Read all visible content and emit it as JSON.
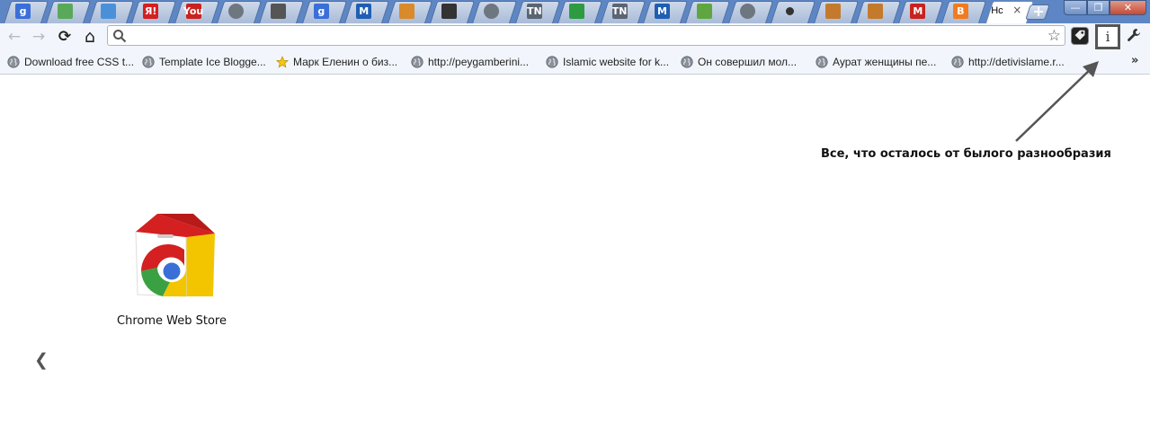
{
  "tabs": [
    {
      "icon": "google-icon",
      "label": "g",
      "color": "#3b6fd8"
    },
    {
      "icon": "picasa-icon",
      "label": "",
      "color": "#5aa85a"
    },
    {
      "icon": "document-icon",
      "label": "",
      "color": "#4a90d9"
    },
    {
      "icon": "yandex-icon",
      "label": "Я!",
      "color": "#d42020"
    },
    {
      "icon": "youtube-icon",
      "label": "You",
      "color": "#c8231f"
    },
    {
      "icon": "globe-icon",
      "label": "",
      "color": "#6e7680"
    },
    {
      "icon": "target-icon",
      "label": "",
      "color": "#555555"
    },
    {
      "icon": "google-icon",
      "label": "g",
      "color": "#3b6fd8"
    },
    {
      "icon": "m-icon",
      "label": "M",
      "color": "#1f5fb3"
    },
    {
      "icon": "compass-icon",
      "label": "",
      "color": "#d98a2b"
    },
    {
      "icon": "avatar-icon",
      "label": "",
      "color": "#333333"
    },
    {
      "icon": "globe-icon",
      "label": "",
      "color": "#6e7680"
    },
    {
      "icon": "tn-icon",
      "label": "TN",
      "color": "#5a6473"
    },
    {
      "icon": "windows-icon",
      "label": "",
      "color": "#2e9b43"
    },
    {
      "icon": "tn-icon",
      "label": "TN",
      "color": "#5a6473"
    },
    {
      "icon": "m-icon",
      "label": "M",
      "color": "#1f5fb3"
    },
    {
      "icon": "money-icon",
      "label": "",
      "color": "#5fa640"
    },
    {
      "icon": "globe-icon",
      "label": "",
      "color": "#6e7680"
    },
    {
      "icon": "dot-icon",
      "label": "",
      "color": "#333333"
    },
    {
      "icon": "food-icon",
      "label": "",
      "color": "#c47a2c"
    },
    {
      "icon": "food-icon",
      "label": "",
      "color": "#c47a2c"
    },
    {
      "icon": "gmail-icon",
      "label": "M",
      "color": "#c8231f"
    },
    {
      "icon": "blogger-icon",
      "label": "B",
      "color": "#f07c22"
    }
  ],
  "active_tab": {
    "title": "Нс",
    "close": "×"
  },
  "new_tab_label": "+",
  "window_controls": {
    "minimize": "—",
    "maximize": "❐",
    "close": "✕"
  },
  "toolbar": {
    "back": "←",
    "forward": "→",
    "reload": "⟳",
    "home": "⌂",
    "star": "☆",
    "wrench": "🔧",
    "ext_info": "i"
  },
  "omnibox": {
    "value": ""
  },
  "bookmarks": [
    {
      "label": "Download free CSS t...",
      "icon": "globe-icon"
    },
    {
      "label": "Template Ice Blogge...",
      "icon": "globe-icon"
    },
    {
      "label": "Марк Еленин о биз...",
      "icon": "star-icon"
    },
    {
      "label": "http://peygamberini...",
      "icon": "globe-icon"
    },
    {
      "label": "Islamic website for k...",
      "icon": "globe-icon"
    },
    {
      "label": "Он совершил мол...",
      "icon": "globe-icon"
    },
    {
      "label": "Аурат женщины пе...",
      "icon": "globe-icon"
    },
    {
      "label": "http://detivislame.r...",
      "icon": "globe-icon"
    }
  ],
  "bookmarks_more": "»",
  "annotation": "Все, что осталось от былого разнообразия",
  "apps": [
    {
      "label": "Chrome Web Store"
    }
  ],
  "nav_prev": "❮",
  "colors": {
    "tabstrip": "#5e86c4",
    "toolbar": "#f2f6fc",
    "annotation_box": "#555555"
  }
}
